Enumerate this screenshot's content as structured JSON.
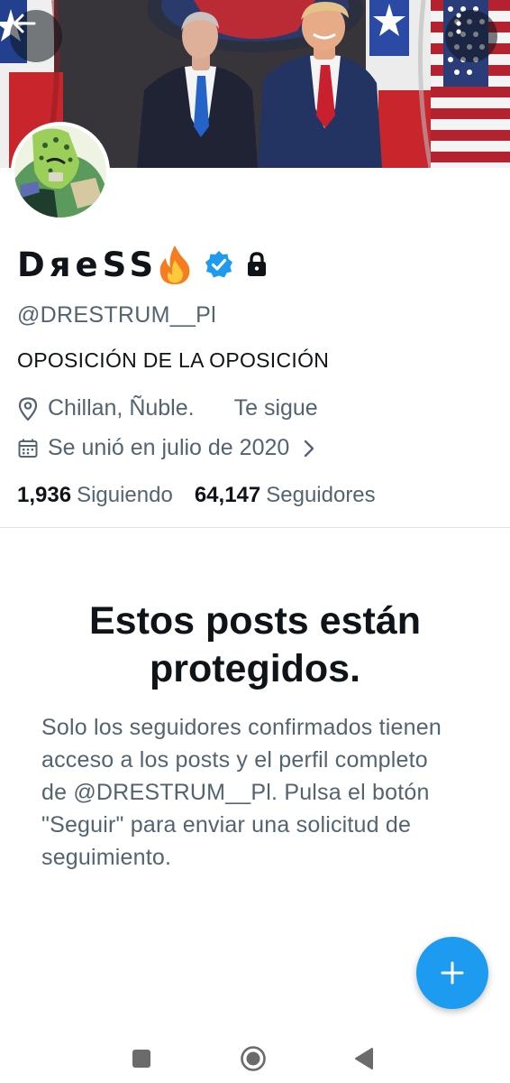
{
  "profile": {
    "display_name": "DяeSS",
    "handle": "@DRESTRUM__Pl",
    "bio": "OPOSICIÓN DE LA OPOSICIÓN",
    "location": "Chillan, Ñuble.",
    "follows_you": "Te sigue",
    "joined": "Se unió en julio de 2020",
    "following_count": "1,936",
    "following_label": "Siguiendo",
    "followers_count": "64,147",
    "followers_label": "Seguidores"
  },
  "protected_notice": {
    "title": "Estos posts están protegidos.",
    "body": "Solo los seguidores confirmados tienen acceso a los posts y el perfil completo de @DRESTRUM__Pl. Pulsa el botón \"Seguir\" para enviar una solicitud de seguimiento."
  },
  "icons": {
    "back": "arrow-left-icon",
    "more": "vertical-dots-icon",
    "fire": "fire-emoji",
    "verified": "verified-badge-icon",
    "lock": "lock-icon",
    "location": "map-pin-icon",
    "calendar": "calendar-icon",
    "chevron": "chevron-right-icon",
    "compose": "plus-icon",
    "nav_recents": "square-icon",
    "nav_home": "circle-icon",
    "nav_back": "triangle-back-icon"
  },
  "colors": {
    "accent": "#1d9bf0",
    "text_primary": "#0f1419",
    "text_secondary": "#536471"
  }
}
